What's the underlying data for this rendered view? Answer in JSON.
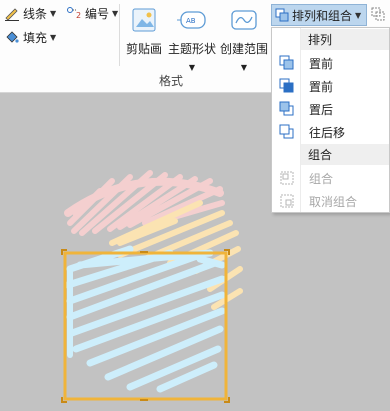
{
  "toolbar": {
    "line_label": "线条",
    "numbering_label": "编号",
    "fill_label": "填充",
    "clipart_label": "剪贴画",
    "theme_shape_label": "主题形状",
    "create_range_label": "创建范围",
    "group_label": "格式"
  },
  "arrange_button": {
    "label": "排列和组合"
  },
  "menu": {
    "section_arrange": "排列",
    "items_arrange": [
      "置前",
      "置前",
      "置后",
      "往后移"
    ],
    "section_group": "组合",
    "items_group": [
      {
        "label": "组合",
        "enabled": false
      },
      {
        "label": "取消组合",
        "enabled": false
      }
    ]
  },
  "colors": {
    "selection": "#f0b43a",
    "pink_scribble": "#f4cfcf",
    "yellow_scribble": "#fbe3b2",
    "blue_scribble": "#cdeefb",
    "menu_highlight": "#bcd6ee"
  }
}
